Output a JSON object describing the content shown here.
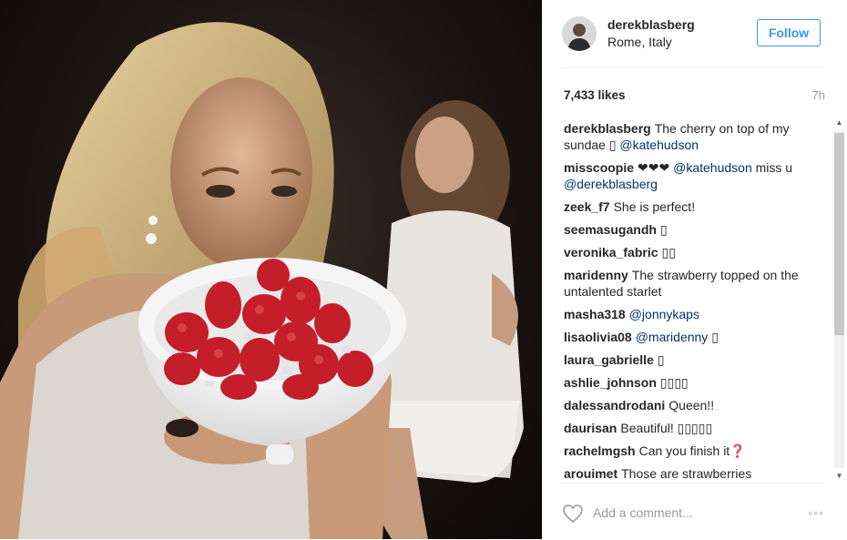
{
  "post": {
    "username": "derekblasberg",
    "location": "Rome, Italy",
    "follow_label": "Follow",
    "likes": "7,433 likes",
    "time": "7h",
    "comment_placeholder": "Add a comment...",
    "more_label": "◦◦◦"
  },
  "comments": [
    {
      "user": "derekblasberg",
      "text": "The cherry on top of my sundae ▯",
      "mention": "@katehudson",
      "tail": ""
    },
    {
      "user": "misscoopie",
      "text": "❤❤❤",
      "mention": "@katehudson",
      "tail": "miss u",
      "mention2": "@derekblasberg"
    },
    {
      "user": "zeek_f7",
      "text": "She is perfect!"
    },
    {
      "user": "seemasugandh",
      "text": "▯"
    },
    {
      "user": "veronika_fabric",
      "text": "▯▯"
    },
    {
      "user": "maridenny",
      "text": "The strawberry topped on the untalented starlet"
    },
    {
      "user": "masha318",
      "mention": "@jonnykaps"
    },
    {
      "user": "lisaolivia08",
      "mention": "@maridenny",
      "tail": "▯"
    },
    {
      "user": "laura_gabrielle",
      "text": "▯"
    },
    {
      "user": "ashlie_johnson",
      "text": "▯▯▯▯"
    },
    {
      "user": "dalessandrodani",
      "text": "Queen!!"
    },
    {
      "user": "daurisan",
      "text": "Beautiful! ▯▯▯▯▯"
    },
    {
      "user": "rachelmgsh",
      "text": "Can you finish it❓"
    },
    {
      "user": "arouimet",
      "text": "Those are strawberries"
    }
  ],
  "colors": {
    "accent": "#3897f0",
    "mention": "#003569",
    "muted": "#999999"
  },
  "icons": {
    "heart": "heart-outline-icon",
    "more": "more-options-icon"
  }
}
